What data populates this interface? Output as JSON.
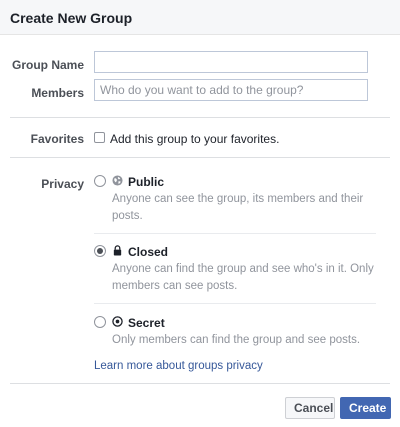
{
  "header": {
    "title": "Create New Group"
  },
  "form": {
    "group_name_label": "Group Name",
    "group_name_value": "",
    "members_label": "Members",
    "members_placeholder": "Who do you want to add to the group?",
    "favorites_label": "Favorites",
    "favorites_text": "Add this group to your favorites.",
    "favorites_checked": false
  },
  "privacy": {
    "label": "Privacy",
    "options": [
      {
        "title": "Public",
        "icon": "globe-icon",
        "description": "Anyone can see the group, its members and their posts.",
        "selected": false
      },
      {
        "title": "Closed",
        "icon": "lock-icon",
        "description": "Anyone can find the group and see who's in it. Only members can see posts.",
        "selected": true
      },
      {
        "title": "Secret",
        "icon": "secret-icon",
        "description": "Only members can find the group and see posts.",
        "selected": false
      }
    ],
    "learn_more": "Learn more about groups privacy"
  },
  "buttons": {
    "cancel": "Cancel",
    "create": "Create"
  },
  "colors": {
    "accent": "#4267b2",
    "link": "#365899",
    "muted": "#90949c"
  }
}
